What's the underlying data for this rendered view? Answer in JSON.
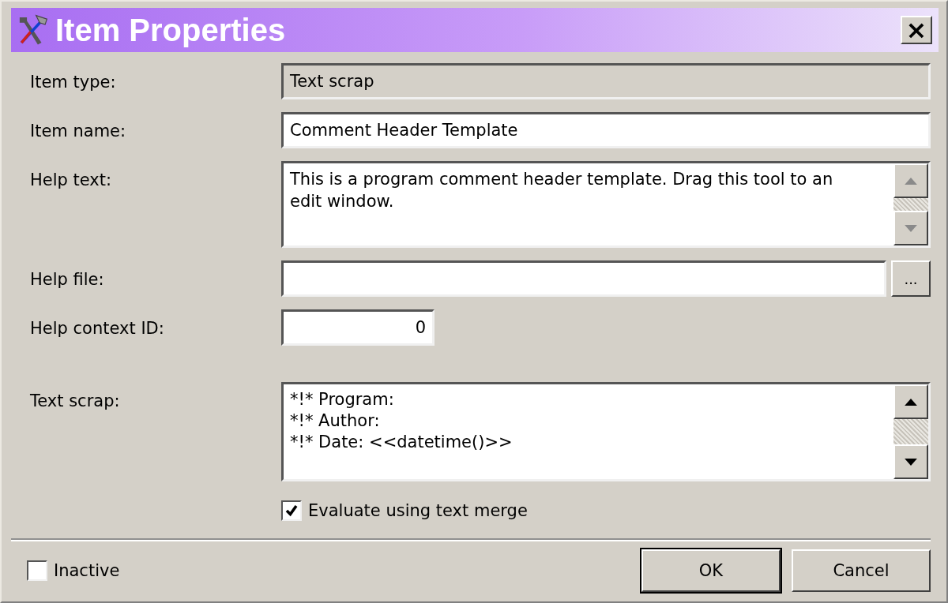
{
  "window": {
    "title": "Item Properties",
    "close": "×"
  },
  "fields": [
    {
      "kind": "readonly",
      "label": "Item type:",
      "value": "Text scrap"
    },
    {
      "kind": "text",
      "label": "Item name:",
      "value": "Comment Header Template"
    },
    {
      "kind": "memo",
      "label": "Help text:",
      "value": "This is a program comment header template. Drag this tool to an edit window.",
      "scroll_enabled": false
    },
    {
      "kind": "browse",
      "label": "Help file:",
      "button": "..."
    },
    {
      "kind": "number",
      "label": "Help context ID:",
      "value": "0"
    },
    {
      "kind": "code",
      "label": "Text scrap:",
      "lines": [
        "*!* Program:",
        "*!* Author:",
        "*!* Date: <<datetime()>>"
      ],
      "scroll_enabled": true
    }
  ],
  "merge_option": {
    "label": "Evaluate using text merge",
    "checked": true
  },
  "inactive": {
    "label": "Inactive",
    "checked": false
  },
  "buttons": [
    {
      "label": "OK",
      "default": true
    },
    {
      "label": "Cancel",
      "default": false
    }
  ]
}
